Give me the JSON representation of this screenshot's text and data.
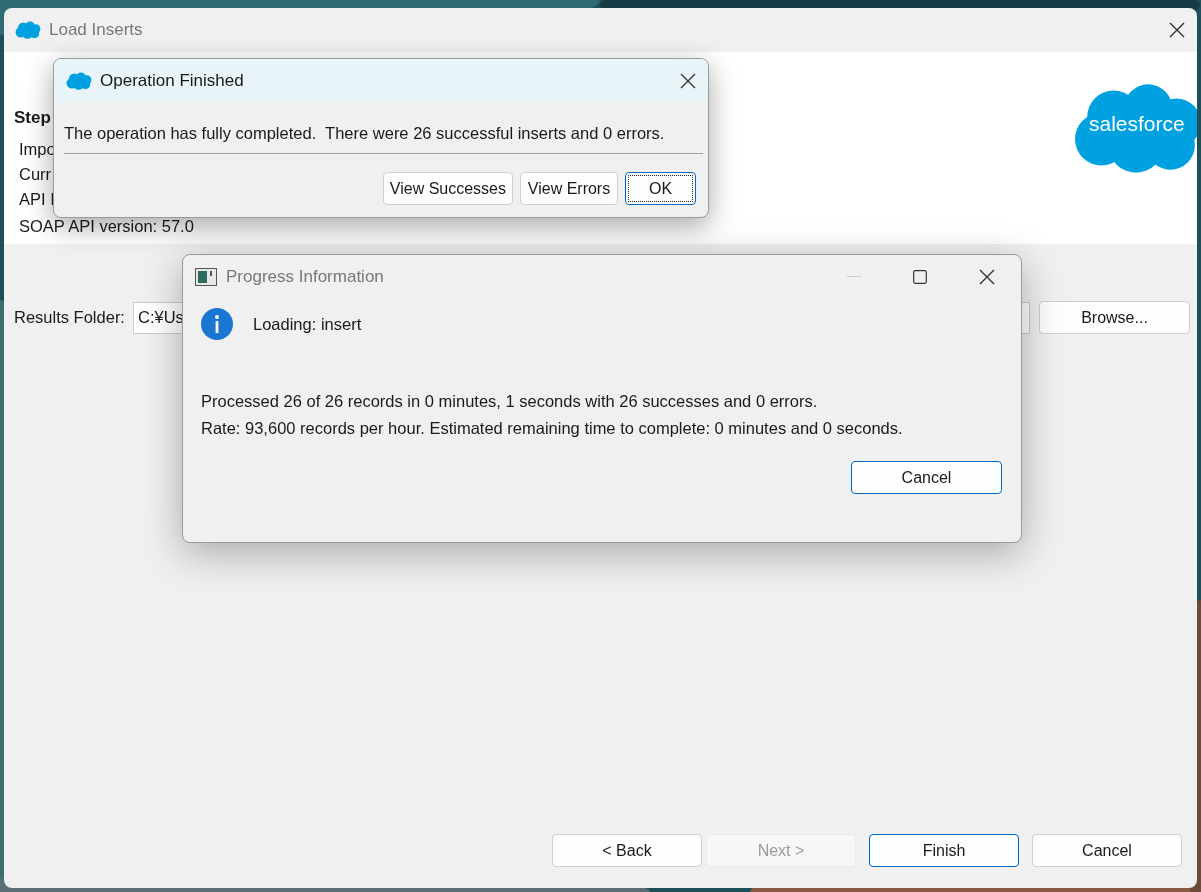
{
  "main_window": {
    "title": "Load Inserts",
    "logo_text": "salesforce",
    "heading": "Step",
    "info_lines": [
      "Impo",
      "Curr",
      "API I",
      "SOAP API version: 57.0"
    ],
    "results_folder": {
      "label": "Results Folder:",
      "value": "C:¥Us"
    },
    "browse_button": "Browse...",
    "buttons": [
      {
        "label": "< Back",
        "disabled": false,
        "default": false
      },
      {
        "label": "Next >",
        "disabled": true,
        "default": false
      },
      {
        "label": "Finish",
        "disabled": false,
        "default": true
      },
      {
        "label": "Cancel",
        "disabled": false,
        "default": false
      }
    ]
  },
  "operation_dialog": {
    "title": "Operation Finished",
    "message": "The operation has fully completed.  There were 26 successful inserts and 0 errors.",
    "buttons": [
      {
        "label": "View Successes",
        "focused": false
      },
      {
        "label": "View Errors",
        "focused": false
      },
      {
        "label": "OK",
        "focused": true
      }
    ]
  },
  "progress_dialog": {
    "title": "Progress Information",
    "status": "Loading: insert",
    "details": [
      "Processed 26 of 26 records in 0 minutes, 1 seconds with 26 successes and 0 errors.",
      "Rate: 93,600 records per hour. Estimated remaining time to complete: 0 minutes and 0 seconds."
    ],
    "cancel_button": {
      "label": "Cancel",
      "default": true
    }
  }
}
